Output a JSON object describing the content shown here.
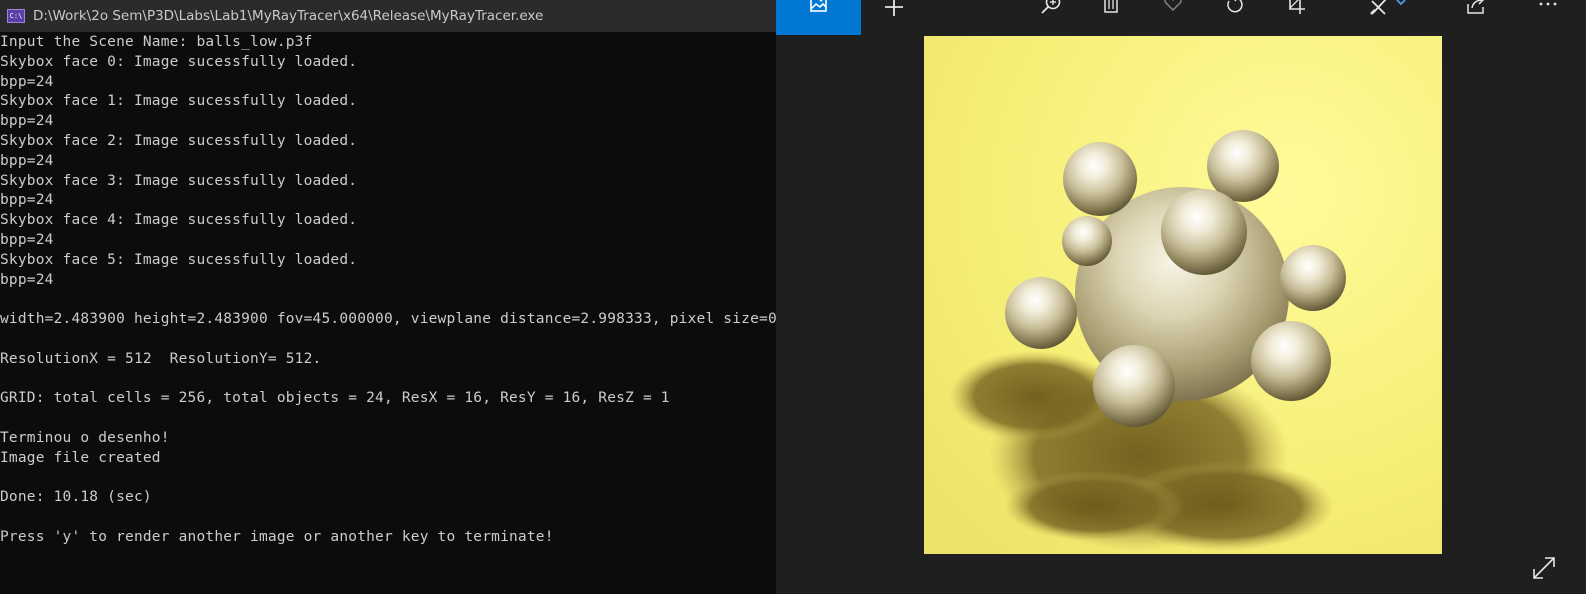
{
  "console": {
    "title": "D:\\Work\\2o Sem\\P3D\\Labs\\Lab1\\MyRayTracer\\x64\\Release\\MyRayTracer.exe",
    "icon_text": "C:\\",
    "lines": [
      "Input the Scene Name: balls_low.p3f",
      "Skybox face 0: Image sucessfully loaded.",
      "bpp=24",
      "Skybox face 1: Image sucessfully loaded.",
      "bpp=24",
      "Skybox face 2: Image sucessfully loaded.",
      "bpp=24",
      "Skybox face 3: Image sucessfully loaded.",
      "bpp=24",
      "Skybox face 4: Image sucessfully loaded.",
      "bpp=24",
      "Skybox face 5: Image sucessfully loaded.",
      "bpp=24",
      "",
      "width=2.483900 height=2.483900 fov=45.000000, viewplane distance=2.998333, pixel size=0",
      "",
      "ResolutionX = 512  ResolutionY= 512.",
      "",
      "GRID: total cells = 256, total objects = 24, ResX = 16, ResY = 16, ResZ = 1",
      "",
      "Terminou o desenho!",
      "Image file created",
      "",
      "Done: 10.18 (sec)",
      "",
      "Press 'y' to render another image or another key to terminate!"
    ]
  },
  "viewer": {
    "accent": "#0078d4",
    "toolbar_icons": [
      "image-icon",
      "plus-icon",
      "zoom-in-icon",
      "delete-icon",
      "heart-icon",
      "rotate-icon",
      "crop-icon",
      "edit-icon",
      "chevron-down-icon",
      "share-icon",
      "more-icon"
    ],
    "fullscreen_icon": "expand-icon",
    "image_background": "#f7f27e"
  }
}
